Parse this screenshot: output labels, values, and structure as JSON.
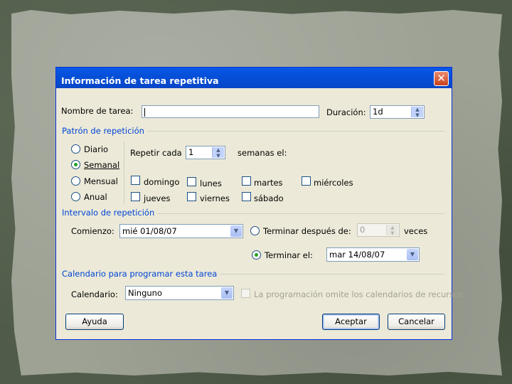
{
  "dialog": {
    "title": "Información de tarea repetitiva",
    "close_glyph": "✕"
  },
  "task": {
    "name_label": "Nombre de tarea:",
    "name_value": "",
    "duration_label": "Duración:",
    "duration_value": "1d"
  },
  "pattern": {
    "group_label": "Patrón de repetición",
    "options": [
      "Diario",
      "Semanal",
      "Mensual",
      "Anual"
    ],
    "selected": "Semanal",
    "repeat_label": "Repetir cada",
    "repeat_value": "1",
    "weeks_label": "semanas el:",
    "days": [
      "domingo",
      "lunes",
      "martes",
      "miércoles",
      "jueves",
      "viernes",
      "sábado"
    ]
  },
  "interval": {
    "group_label": "Intervalo de repetición",
    "start_label": "Comienzo:",
    "start_value": "mié 01/08/07",
    "end_after_label": "Terminar después de:",
    "end_after_value": "0",
    "times_label": "veces",
    "end_by_label": "Terminar el:",
    "end_by_value": "mar 14/08/07",
    "selected": "Terminar el:"
  },
  "calendar": {
    "group_label": "Calendario para programar esta tarea",
    "calendar_label": "Calendario:",
    "calendar_value": "Ninguno",
    "ignore_label": "La programación omite los calendarios de recursos"
  },
  "buttons": {
    "help": "Ayuda",
    "ok": "Aceptar",
    "cancel": "Cancelar"
  },
  "colors": {
    "titlebar": "#0550d9",
    "group_label": "#0046d5",
    "dialog_bg": "#ece9d8",
    "backdrop": "#9ea295"
  }
}
